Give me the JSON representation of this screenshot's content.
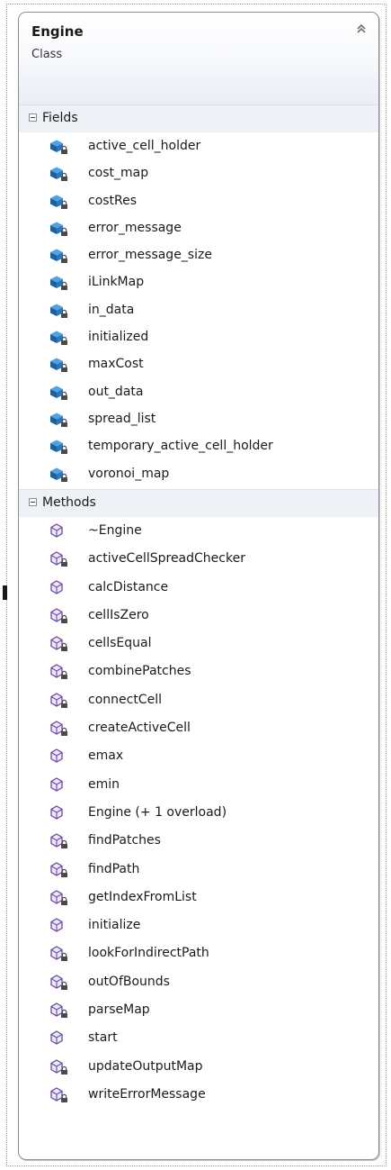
{
  "class_shape": {
    "name": "Engine",
    "kind": "Class"
  },
  "sections": {
    "fields": {
      "title": "Fields",
      "items": [
        {
          "label": "active_cell_holder",
          "icon": "private-field-icon"
        },
        {
          "label": "cost_map",
          "icon": "private-field-icon"
        },
        {
          "label": "costRes",
          "icon": "private-field-icon"
        },
        {
          "label": "error_message",
          "icon": "private-field-icon"
        },
        {
          "label": "error_message_size",
          "icon": "private-field-icon"
        },
        {
          "label": "iLinkMap",
          "icon": "private-field-icon"
        },
        {
          "label": "in_data",
          "icon": "private-field-icon"
        },
        {
          "label": "initialized",
          "icon": "private-field-icon"
        },
        {
          "label": "maxCost",
          "icon": "private-field-icon"
        },
        {
          "label": "out_data",
          "icon": "private-field-icon"
        },
        {
          "label": "spread_list",
          "icon": "private-field-icon"
        },
        {
          "label": "temporary_active_cell_holder",
          "icon": "private-field-icon"
        },
        {
          "label": "voronoi_map",
          "icon": "private-field-icon"
        }
      ]
    },
    "methods": {
      "title": "Methods",
      "items": [
        {
          "label": "~Engine",
          "icon": "public-method-icon"
        },
        {
          "label": "activeCellSpreadChecker",
          "icon": "private-method-icon"
        },
        {
          "label": "calcDistance",
          "icon": "public-method-icon"
        },
        {
          "label": "cellIsZero",
          "icon": "private-method-icon"
        },
        {
          "label": "cellsEqual",
          "icon": "private-method-icon"
        },
        {
          "label": "combinePatches",
          "icon": "private-method-icon"
        },
        {
          "label": "connectCell",
          "icon": "private-method-icon"
        },
        {
          "label": "createActiveCell",
          "icon": "private-method-icon"
        },
        {
          "label": "emax",
          "icon": "public-method-icon"
        },
        {
          "label": "emin",
          "icon": "public-method-icon"
        },
        {
          "label": "Engine (+ 1 overload)",
          "icon": "public-method-icon"
        },
        {
          "label": "findPatches",
          "icon": "private-method-icon"
        },
        {
          "label": "findPath",
          "icon": "private-method-icon"
        },
        {
          "label": "getIndexFromList",
          "icon": "private-method-icon"
        },
        {
          "label": "initialize",
          "icon": "public-method-icon"
        },
        {
          "label": "lookForIndirectPath",
          "icon": "private-method-icon"
        },
        {
          "label": "outOfBounds",
          "icon": "private-method-icon"
        },
        {
          "label": "parseMap",
          "icon": "private-method-icon"
        },
        {
          "label": "start",
          "icon": "public-method-icon"
        },
        {
          "label": "updateOutputMap",
          "icon": "private-method-icon"
        },
        {
          "label": "writeErrorMessage",
          "icon": "private-method-icon"
        }
      ]
    }
  },
  "colors": {
    "field_icon_top": "#4fa3e3",
    "field_icon_side": "#1f5f9c",
    "method_icon_stroke": "#6b4aa0",
    "method_icon_fill": "#efe7fa",
    "lock_color": "#4a4a4a"
  }
}
